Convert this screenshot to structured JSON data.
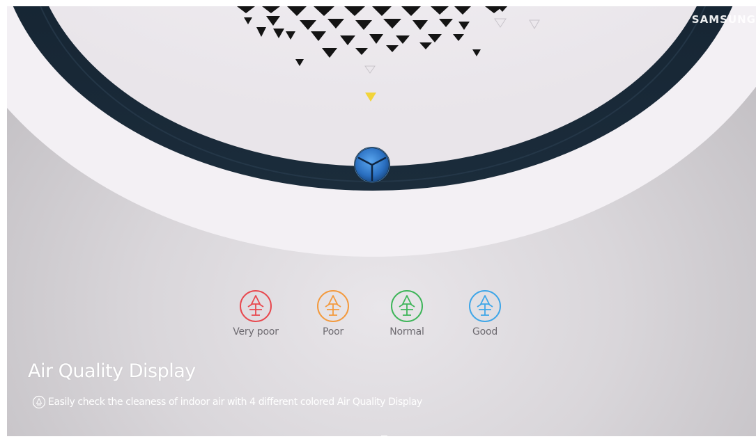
{
  "brand": {
    "logo_text": "SAMSUNG"
  },
  "quality_levels": [
    {
      "label": "Very poor",
      "color": "#e8484e",
      "icon": "air-quality-icon"
    },
    {
      "label": "Poor",
      "color": "#f39a3e",
      "icon": "air-quality-icon"
    },
    {
      "label": "Normal",
      "color": "#3fb55a",
      "icon": "air-quality-icon"
    },
    {
      "label": "Good",
      "color": "#3fa6e8",
      "icon": "air-quality-icon"
    }
  ],
  "caption": {
    "title": "Air Quality Display",
    "description": "Easily check the cleaness of indoor air with 4 different colored Air Quality Display",
    "icon": "air-quality-icon"
  },
  "colors": {
    "ring": "#152433",
    "panel": "#f1eef2",
    "center_button": "#2b73c4",
    "indicator": "#f2d43a"
  }
}
